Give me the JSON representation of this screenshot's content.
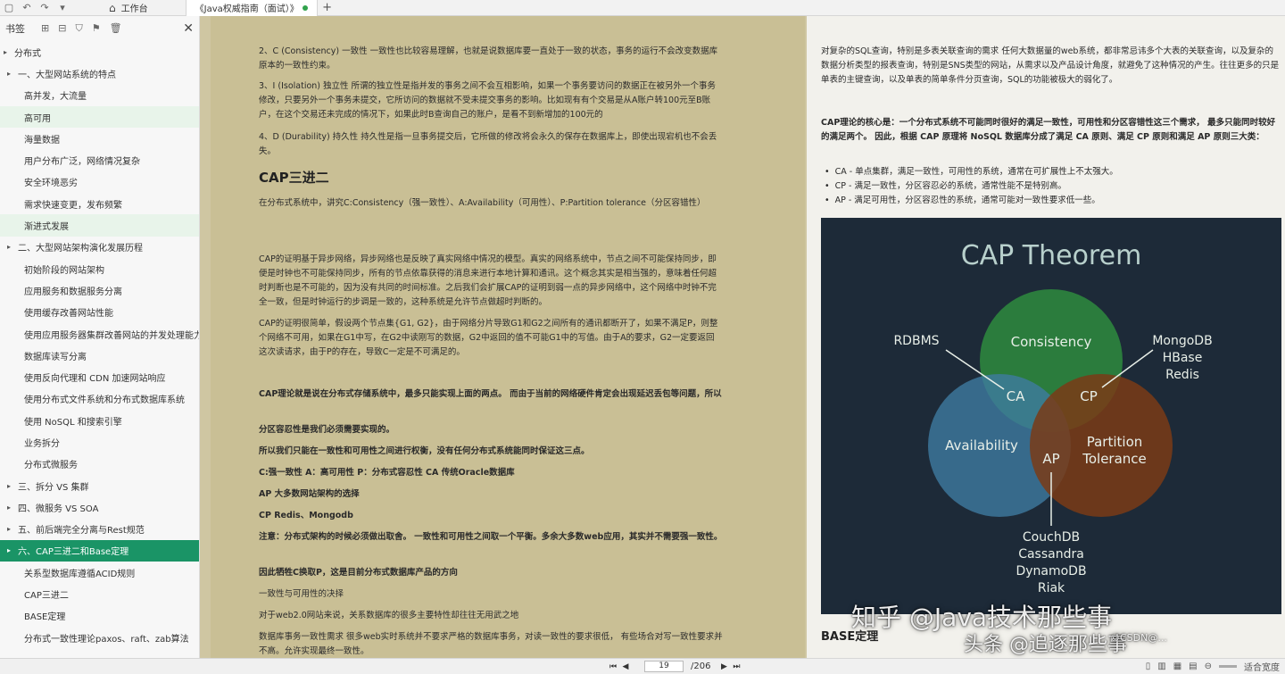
{
  "topbar": {
    "tab_home": "工作台",
    "tab_doc": "《Java权威指南（面试）》",
    "new_tab_symbol": "+"
  },
  "sidebar": {
    "title": "书签",
    "items": [
      {
        "label": "分布式",
        "level": 0,
        "state": ""
      },
      {
        "label": "一、大型网站系统的特点",
        "level": 1,
        "state": ""
      },
      {
        "label": "高并发，大流量",
        "level": 2,
        "state": ""
      },
      {
        "label": "高可用",
        "level": 2,
        "state": "hl"
      },
      {
        "label": "海量数据",
        "level": 2,
        "state": ""
      },
      {
        "label": "用户分布广泛，网络情况复杂",
        "level": 2,
        "state": ""
      },
      {
        "label": "安全环境恶劣",
        "level": 2,
        "state": ""
      },
      {
        "label": "需求快速变更，发布频繁",
        "level": 2,
        "state": ""
      },
      {
        "label": "渐进式发展",
        "level": 2,
        "state": "hl"
      },
      {
        "label": "二、大型网站架构演化发展历程",
        "level": 1,
        "state": ""
      },
      {
        "label": "初始阶段的网站架构",
        "level": 2,
        "state": ""
      },
      {
        "label": "应用服务和数据服务分离",
        "level": 2,
        "state": ""
      },
      {
        "label": "使用缓存改善网站性能",
        "level": 2,
        "state": ""
      },
      {
        "label": "使用应用服务器集群改善网站的并发处理能力",
        "level": 2,
        "state": ""
      },
      {
        "label": "数据库读写分离",
        "level": 2,
        "state": ""
      },
      {
        "label": "使用反向代理和 CDN 加速网站响应",
        "level": 2,
        "state": ""
      },
      {
        "label": "使用分布式文件系统和分布式数据库系统",
        "level": 2,
        "state": ""
      },
      {
        "label": "使用 NoSQL 和搜索引擎",
        "level": 2,
        "state": ""
      },
      {
        "label": "业务拆分",
        "level": 2,
        "state": ""
      },
      {
        "label": "分布式微服务",
        "level": 2,
        "state": ""
      },
      {
        "label": "三、拆分 VS 集群",
        "level": 1,
        "state": ""
      },
      {
        "label": "四、微服务 VS SOA",
        "level": 1,
        "state": ""
      },
      {
        "label": "五、前后端完全分离与Rest规范",
        "level": 1,
        "state": ""
      },
      {
        "label": "六、CAP三进二和Base定理",
        "level": 1,
        "state": "active"
      },
      {
        "label": "关系型数据库遵循ACID规则",
        "level": 2,
        "state": ""
      },
      {
        "label": "CAP三进二",
        "level": 2,
        "state": ""
      },
      {
        "label": "BASE定理",
        "level": 2,
        "state": ""
      },
      {
        "label": "分布式一致性理论paxos、raft、zab算法",
        "level": 2,
        "state": ""
      }
    ]
  },
  "left_page": {
    "p1": "2、C (Consistency) 一致性 一致性也比较容易理解，也就是说数据库要一直处于一致的状态，事务的运行不会改变数据库原本的一致性约束。",
    "p2": "3、I (Isolation) 独立性 所谓的独立性是指并发的事务之间不会互相影响，如果一个事务要访问的数据正在被另外一个事务修改，只要另外一个事务未提交，它所访问的数据就不受未提交事务的影响。比如现有有个交易是从A账户转100元至B账户，在这个交易还未完成的情况下，如果此时B查询自己的账户，是看不到新增加的100元的",
    "p3": "4、D (Durability) 持久性 持久性是指一旦事务提交后，它所做的修改将会永久的保存在数据库上，即使出现宕机也不会丢失。",
    "heading": "CAP三进二",
    "p4": "在分布式系统中，讲究C:Consistency（强一致性）、A:Availability（可用性）、P:Partition tolerance（分区容错性）",
    "p5": "CAP的证明基于异步网络，异步网络也是反映了真实网络中情况的模型。真实的网络系统中，节点之间不可能保持同步，即便是时钟也不可能保持同步，所有的节点依靠获得的消息来进行本地计算和通讯。这个概念其实是相当强的，意味着任何超时判断也是不可能的，因为没有共同的时间标准。之后我们会扩展CAP的证明到弱一点的异步网络中，这个网络中时钟不完全一致，但是时钟运行的步调是一致的，这种系统是允许节点做超时判断的。",
    "p6": "CAP的证明很简单，假设两个节点集{G1, G2}，由于网络分片导致G1和G2之间所有的通讯都断开了，如果不满足P，则整个网络不可用，如果在G1中写，在G2中读刚写的数据，G2中返回的值不可能G1中的写值。由于A的要求，G2一定要返回这次读请求，由于P的存在，导致C一定是不可满足的。",
    "b1": "CAP理论就是说在分布式存储系统中，最多只能实现上面的两点。 而由于当前的网络硬件肯定会出现延迟丢包等问题，所以",
    "b2": "分区容忍性是我们必须需要实现的。",
    "b3": "所以我们只能在一致性和可用性之间进行权衡，没有任何分布式系统能同时保证这三点。",
    "b4": "C:强一致性 A：高可用性 P：分布式容忍性 CA 传统Oracle数据库",
    "b5": "AP 大多数网站架构的选择",
    "b6": "CP Redis、Mongodb",
    "b7": "注意：分布式架构的时候必须做出取舍。 一致性和可用性之间取一个平衡。多余大多数web应用，其实并不需要强一致性。",
    "b8": "因此牺牲C换取P，这是目前分布式数据库产品的方向",
    "p7": "一致性与可用性的决择",
    "p8": "对于web2.0网站来说，关系数据库的很多主要特性却往往无用武之地",
    "p9": "数据库事务一致性需求 很多web实时系统并不要求严格的数据库事务，对读一致性的要求很低， 有些场合对写一致性要求并不高。允许实现最终一致性。"
  },
  "right_page": {
    "p1": "对复杂的SQL查询，特别是多表关联查询的需求 任何大数据量的web系统，都非常忌讳多个大表的关联查询，以及复杂的数据分析类型的报表查询，特别是SNS类型的网站，从需求以及产品设计角度，就避免了这种情况的产生。往往更多的只是单表的主键查询，以及单表的简单条件分页查询，SQL的功能被极大的弱化了。",
    "b1": "CAP理论的核心是：一个分布式系统不可能同时很好的满足一致性，可用性和分区容错性这三个需求， 最多只能同时较好的满足两个。 因此，根据 CAP 原理将 NoSQL 数据库分成了满足 CA 原则、满足 CP 原则和满足 AP 原则三大类：",
    "bullets": [
      "CA - 单点集群，满足一致性，可用性的系统，通常在可扩展性上不太强大。",
      "CP - 满足一致性，分区容忍必的系统，通常性能不是特别高。",
      "AP - 满足可用性，分区容忍性的系统，通常可能对一致性要求低一些。"
    ],
    "diagram": {
      "title": "CAP Theorem",
      "consistency": "Consistency",
      "availability": "Availability",
      "partition_line1": "Partition",
      "partition_line2": "Tolerance",
      "ca": "CA",
      "cp": "CP",
      "ap": "AP",
      "rdbms": "RDBMS",
      "cp_db1": "MongoDB",
      "cp_db2": "HBase",
      "cp_db3": "Redis",
      "ap_db1": "CouchDB",
      "ap_db2": "Cassandra",
      "ap_db3": "DynamoDB",
      "ap_db4": "Riak",
      "colors": {
        "background": "#1d2a38",
        "consistency": "#2e8b3e",
        "availability": "#3f7aa0",
        "partition": "#7a3b16"
      }
    },
    "base_heading": "BASE定理"
  },
  "watermarks": {
    "zhihu": "知乎 @Java技术那些事",
    "toutiao": "头条 @追逐那些事",
    "icon_line": "©CSDN@..."
  },
  "bottombar": {
    "current_page": "19",
    "total_pages": "/206",
    "fit_label": "适合宽度"
  }
}
